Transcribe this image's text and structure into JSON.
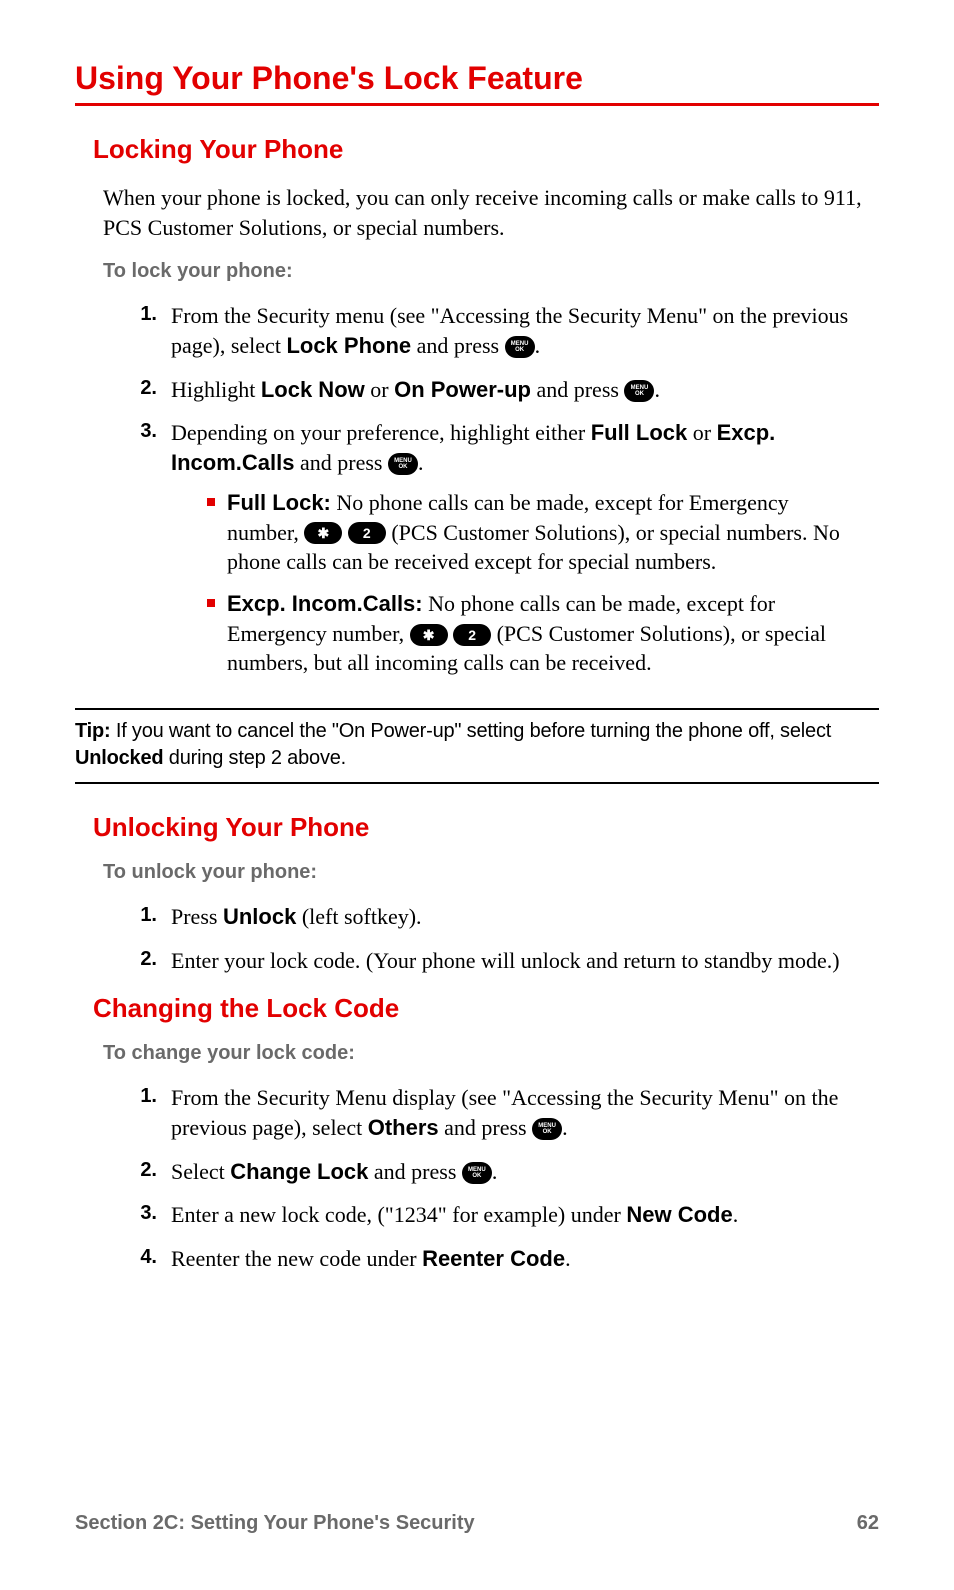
{
  "title": "Using Your Phone's Lock Feature",
  "sections": {
    "locking": {
      "heading": "Locking Your Phone",
      "intro": "When your phone is locked, you can only receive incoming calls or make calls to 911, PCS Customer Solutions, or special numbers.",
      "instr": "To lock your phone:",
      "steps": {
        "s1_a": "From the Security menu (see \"Accessing the Security Menu\" on the previous page), select ",
        "s1_bold": "Lock Phone",
        "s1_b": " and press ",
        "s2_a": "Highlight ",
        "s2_bold1": "Lock Now",
        "s2_b": " or ",
        "s2_bold2": "On Power-up",
        "s2_c": " and press ",
        "s3_a": "Depending on your preference, highlight either ",
        "s3_bold1": "Full Lock",
        "s3_b": " or ",
        "s3_bold2": "Excp. Incom.Calls",
        "s3_c": " and press "
      },
      "bullets": {
        "b1_label": "Full Lock:",
        "b1_a": " No phone calls can be made, except for Emergency number, ",
        "b1_b": " (PCS Customer Solutions), or special numbers. No phone calls can be received except for special numbers.",
        "b2_label": "Excp. Incom.Calls:",
        "b2_a": " No phone calls can be made, except for Emergency number, ",
        "b2_b": " (PCS Customer Solutions), or special numbers, but all incoming calls can be received."
      }
    },
    "tip": {
      "label": "Tip:",
      "text_a": " If you want to cancel the \"On Power-up\" setting before turning the phone off, select ",
      "bold": "Unlocked",
      "text_b": " during step 2 above."
    },
    "unlocking": {
      "heading": "Unlocking Your Phone",
      "instr": "To unlock your phone:",
      "steps": {
        "s1_a": "Press ",
        "s1_bold": "Unlock",
        "s1_b": " (left softkey).",
        "s2": "Enter your lock code. (Your phone will unlock and return to standby mode.)"
      }
    },
    "changing": {
      "heading": "Changing the Lock Code",
      "instr": "To change your lock code:",
      "steps": {
        "s1_a": "From the Security Menu display (see \"Accessing the Security Menu\" on the previous page), select ",
        "s1_bold": "Others",
        "s1_b": " and press ",
        "s2_a": "Select ",
        "s2_bold": "Change Lock",
        "s2_b": " and press ",
        "s3_a": "Enter a new lock code, (\"1234\" for example) under ",
        "s3_bold": "New Code",
        "s4_a": "Reenter the new code under ",
        "s4_bold": "Reenter Code"
      }
    }
  },
  "keys": {
    "menu_ok_top": "MENU",
    "menu_ok_bot": "OK",
    "star": "✱",
    "two": "2"
  },
  "footer": {
    "section": "Section 2C: Setting Your Phone's Security",
    "page": "62"
  },
  "nums": {
    "n1": "1.",
    "n2": "2.",
    "n3": "3.",
    "n4": "4."
  },
  "period": "."
}
